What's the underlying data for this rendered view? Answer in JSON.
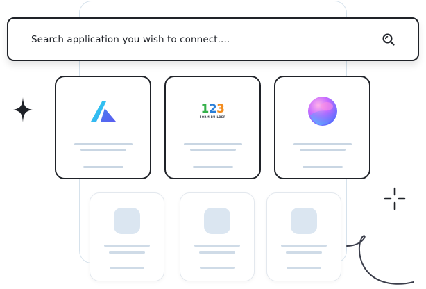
{
  "search": {
    "text": "Search application you wish to connect....",
    "icon": "search-icon"
  },
  "apps": [
    {
      "name": "app-a-logo",
      "icon": "stylized-a-icon",
      "colors": [
        "#2ad4f0",
        "#5a5cf0"
      ]
    },
    {
      "name": "123formbuilder-logo",
      "icon": "123-form-builder-logo",
      "digits": [
        "1",
        "2",
        "3"
      ],
      "subtitle": "FORM BUILDER",
      "colors": [
        "#35b04a",
        "#2a7fd8",
        "#f28c1e"
      ]
    },
    {
      "name": "orb-logo",
      "icon": "gradient-orb-icon",
      "colors": [
        "#ff6bd6",
        "#6b5cff",
        "#5ad0ff"
      ]
    }
  ],
  "colors": {
    "border_dark": "#1f2228",
    "skeleton_line": "#c9d6e3",
    "skeleton_block": "#dbe6f1",
    "panel_border": "#d6e2ec"
  },
  "decorations": [
    "sparkle-star-icon",
    "crosshair-sparkle-icon",
    "curved-line-doodle"
  ]
}
